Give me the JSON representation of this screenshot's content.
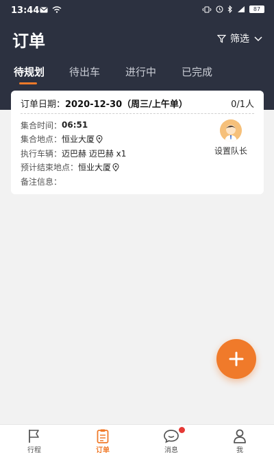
{
  "status_bar": {
    "time": "13:44",
    "battery": "87",
    "icons": [
      "mail-icon",
      "wifi-icon",
      "vibrate-icon",
      "alarm-icon",
      "bluetooth-icon",
      "signal-icon",
      "battery-icon"
    ]
  },
  "header": {
    "title": "订单",
    "filter_label": "筛选"
  },
  "tabs": [
    {
      "label": "待规划",
      "active": true
    },
    {
      "label": "待出车",
      "active": false
    },
    {
      "label": "进行中",
      "active": false
    },
    {
      "label": "已完成",
      "active": false
    }
  ],
  "order_card": {
    "date_label": "订单日期：",
    "date_value": "2020-12-30（周三/上午单）",
    "count": "0/1人",
    "rows": [
      {
        "label": "集合时间：",
        "value": "06:51"
      },
      {
        "label": "集合地点：",
        "value": "恒业大厦"
      },
      {
        "label": "执行车辆：",
        "value": "迈巴赫 迈巴赫 x1"
      },
      {
        "label": "预计结束地点：",
        "value": "恒业大厦"
      },
      {
        "label": "备注信息：",
        "value": ""
      }
    ],
    "captain_label": "设置队长"
  },
  "fab": {
    "icon": "plus-icon"
  },
  "bottom_nav": [
    {
      "label": "行程",
      "icon": "flag-icon",
      "active": false
    },
    {
      "label": "订单",
      "icon": "clipboard-icon",
      "active": true
    },
    {
      "label": "消息",
      "icon": "chat-icon",
      "active": false
    },
    {
      "label": "我",
      "icon": "person-icon",
      "active": false
    }
  ],
  "colors": {
    "header_bg": "#2c3140",
    "accent": "#f07a2a",
    "page_bg": "#f2f2f2"
  }
}
